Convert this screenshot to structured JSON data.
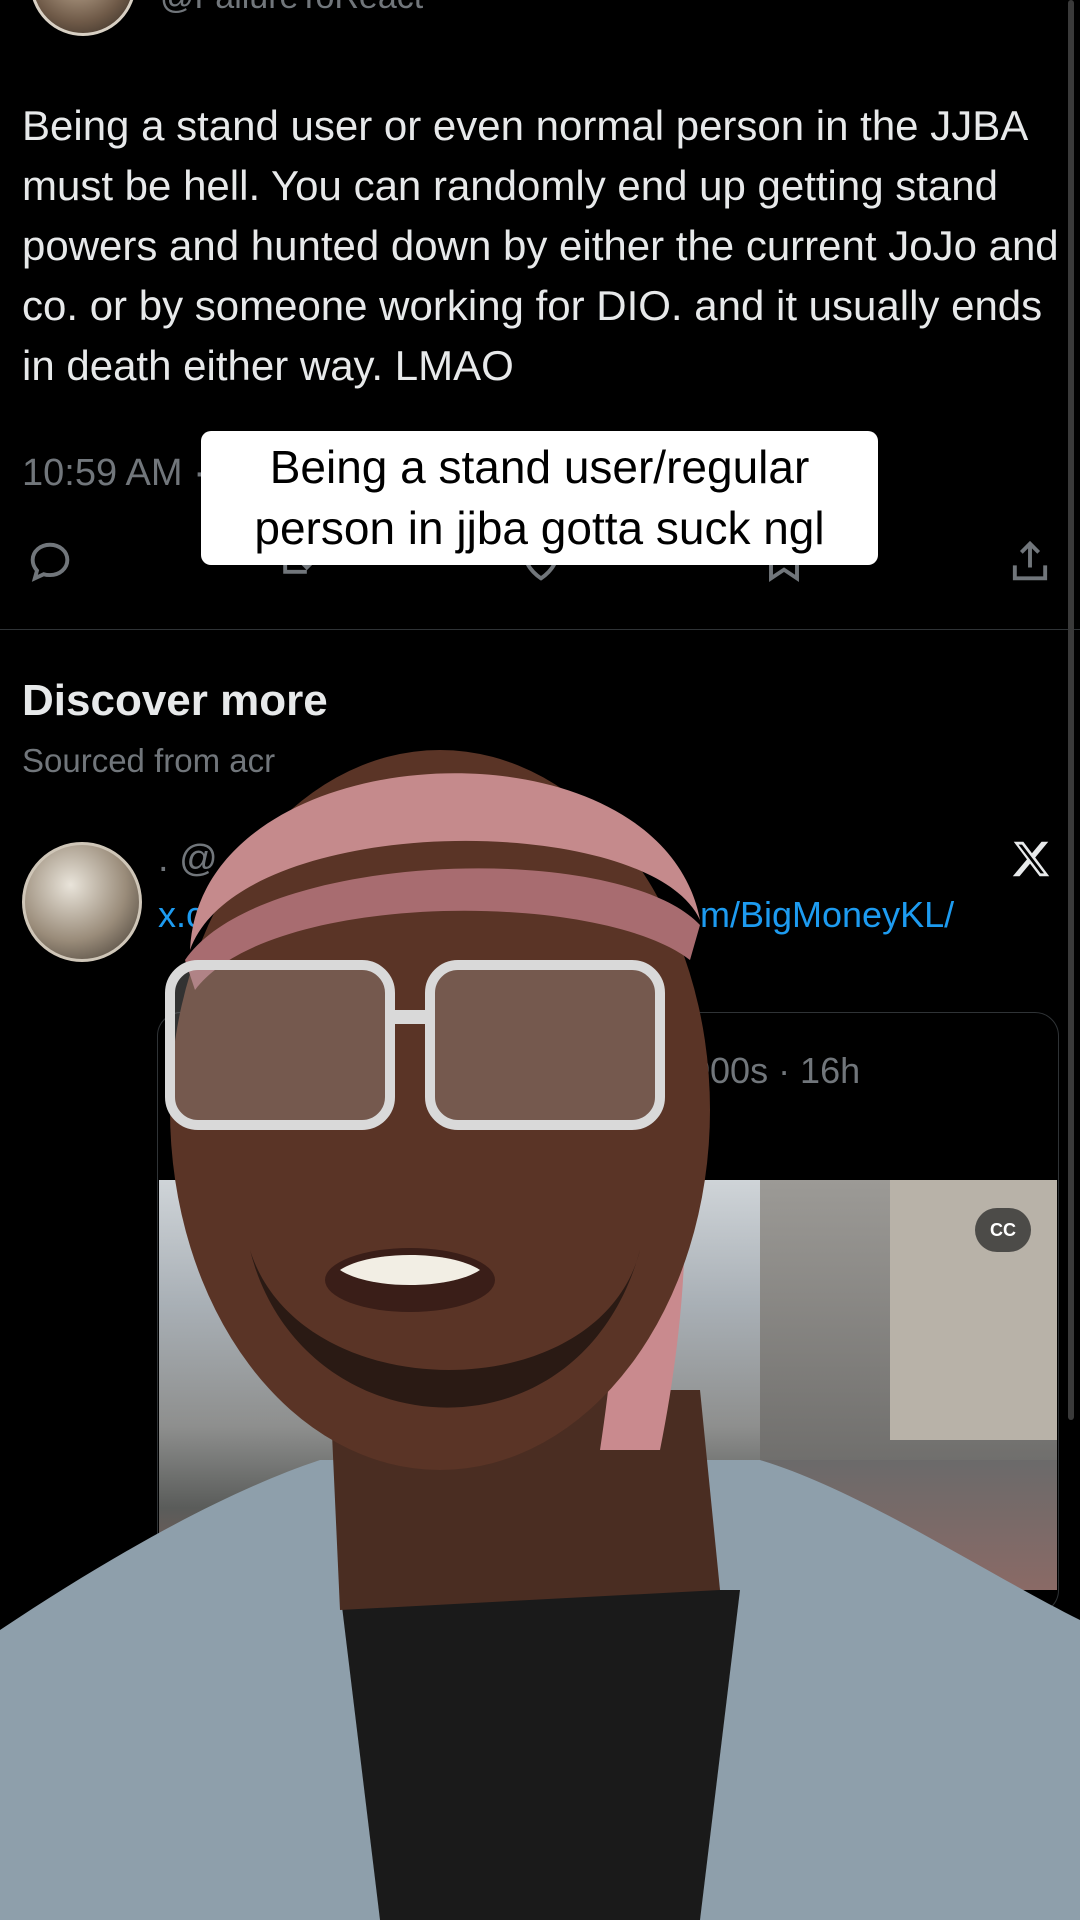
{
  "header": {
    "handle": "@FailureToReact"
  },
  "tweet": {
    "text": "Being a stand user or even normal person in the JJBA must be hell. You can randomly end up getting stand powers and hunted down by either the current JoJo and co. or by someone working for DIO. and it usually ends in death either way. LMAO",
    "time": "10:59 AM ·"
  },
  "caption": {
    "line1": "Being a stand user/regular",
    "line2": "person in jjba gotta suck ngl"
  },
  "actions": [
    "comment-icon",
    "retweet-icon",
    "like-icon",
    "bookmark-icon",
    "share-icon"
  ],
  "discover": {
    "title": "Discover more",
    "subtitle": "Sourced from acr"
  },
  "card": {
    "handle": ". @",
    "link_start": "x.c",
    "link_end": "m/BigMoneyKL/",
    "embed_meta": "000s · 16h",
    "cc_label": "CC"
  },
  "colors": {
    "background": "#000000",
    "text": "#e7e9ea",
    "muted": "#71767b",
    "link": "#1d9bf0"
  }
}
